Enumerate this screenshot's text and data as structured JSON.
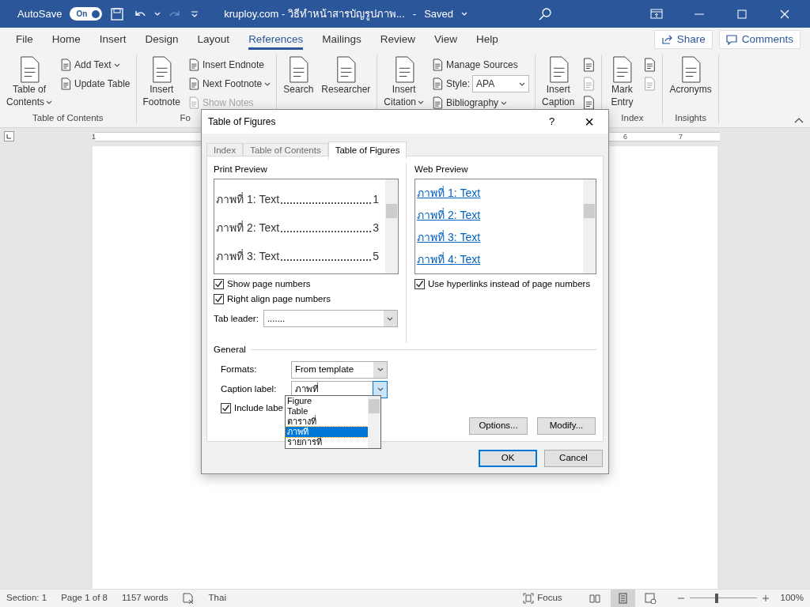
{
  "title_bar": {
    "autosave_label": "AutoSave",
    "autosave_toggle": {
      "label": "On",
      "on": true
    },
    "document_title": "kruploy.com - วิธีทำหน้าสารบัญรูปภาพ...",
    "save_state": "Saved",
    "separator": "-"
  },
  "menu_tabs": [
    {
      "label": "File",
      "selected": false
    },
    {
      "label": "Home",
      "selected": false
    },
    {
      "label": "Insert",
      "selected": false
    },
    {
      "label": "Design",
      "selected": false
    },
    {
      "label": "Layout",
      "selected": false
    },
    {
      "label": "References",
      "selected": true
    },
    {
      "label": "Mailings",
      "selected": false
    },
    {
      "label": "Review",
      "selected": false
    },
    {
      "label": "View",
      "selected": false
    },
    {
      "label": "Help",
      "selected": false
    }
  ],
  "share_button": "Share",
  "comments_button": "Comments",
  "ribbon_groups": [
    {
      "label": "Table of Contents",
      "large": [
        {
          "lines": [
            "Table of",
            "Contents"
          ],
          "dropdown": true
        }
      ],
      "small": [
        {
          "label": "Add Text",
          "dropdown": true
        },
        {
          "label": "Update Table"
        }
      ]
    },
    {
      "label": "Fo",
      "large": [
        {
          "lines": [
            "Insert",
            "Footnote"
          ]
        }
      ],
      "small": [
        {
          "label": "Insert Endnote"
        },
        {
          "label": "Next Footnote",
          "dropdown": true
        },
        {
          "label": "Show Notes",
          "disabled": true
        }
      ]
    },
    {
      "large": [
        {
          "lines": [
            "Search"
          ]
        },
        {
          "lines": [
            "Researcher"
          ]
        }
      ]
    },
    {
      "large": [
        {
          "lines": [
            "Insert",
            "Citation"
          ],
          "dropdown": true
        }
      ],
      "small": [
        {
          "label": "Manage Sources"
        },
        {
          "label": "Style:",
          "kind": "combo",
          "value": "APA"
        },
        {
          "label": "Bibliography",
          "dropdown": true
        }
      ]
    },
    {
      "large": [
        {
          "lines": [
            "Insert",
            "Caption"
          ]
        }
      ],
      "icons": [
        {
          "disabled": false
        },
        {
          "disabled": true
        },
        {
          "disabled": false
        }
      ]
    },
    {
      "label": "Index",
      "large": [
        {
          "lines": [
            "Mark",
            "Entry"
          ]
        }
      ],
      "icons": [
        {
          "disabled": false
        },
        {
          "disabled": true
        }
      ]
    },
    {
      "label": "Insights",
      "large": [
        {
          "lines": [
            "Acronyms"
          ]
        }
      ]
    }
  ],
  "ruler_numbers": [
    "1",
    "6",
    "7"
  ],
  "dialog": {
    "title": "Table of Figures",
    "help": "?",
    "close": "×",
    "tabs": [
      {
        "label": "Index",
        "selected": false
      },
      {
        "label": "Table of Contents",
        "selected": false
      },
      {
        "label": "Table of Figures",
        "selected": true
      }
    ],
    "print_preview": {
      "label": "Print Preview",
      "entries": [
        {
          "caption": "ภาพที่ 1: Text",
          "page": "1"
        },
        {
          "caption": "ภาพที่ 2: Text",
          "page": "3"
        },
        {
          "caption": "ภาพที่ 3: Text",
          "page": "5"
        }
      ]
    },
    "web_preview": {
      "label": "Web Preview",
      "entries": [
        "ภาพที่ 1: Text",
        "ภาพที่ 2: Text",
        "ภาพที่ 3: Text",
        "ภาพที่ 4: Text"
      ]
    },
    "show_page_numbers": {
      "label": "Show page numbers",
      "checked": true
    },
    "right_align": {
      "label": "Right align page numbers",
      "checked": true
    },
    "use_hyperlinks": {
      "label": "Use hyperlinks instead of page numbers",
      "checked": true
    },
    "tab_leader": {
      "label": "Tab leader:",
      "value": "......."
    },
    "general_label": "General",
    "formats": {
      "label": "Formats:",
      "value": "From template"
    },
    "caption_label": {
      "label": "Caption label:",
      "value": "ภาพที่",
      "options": [
        {
          "label": "Figure",
          "selected": false
        },
        {
          "label": "Table",
          "selected": false
        },
        {
          "label": "ตารางที่",
          "selected": false
        },
        {
          "label": "ภาพที่",
          "selected": true
        },
        {
          "label": "รายการที่",
          "selected": false
        }
      ]
    },
    "include_label": {
      "label": "Include labe",
      "checked": true
    },
    "buttons": [
      {
        "label": "Options...",
        "default": false
      },
      {
        "label": "Modify...",
        "default": false
      },
      {
        "label": "OK",
        "default": true
      },
      {
        "label": "Cancel",
        "default": false
      }
    ]
  },
  "status_bar": {
    "section": "Section: 1",
    "page": "Page 1 of 8",
    "words": "1157 words",
    "language": "Thai",
    "focus": "Focus",
    "views": [
      {
        "selected": false
      },
      {
        "selected": true
      },
      {
        "selected": false
      }
    ],
    "zoom": {
      "level": 0.4,
      "reading": "100%"
    }
  }
}
